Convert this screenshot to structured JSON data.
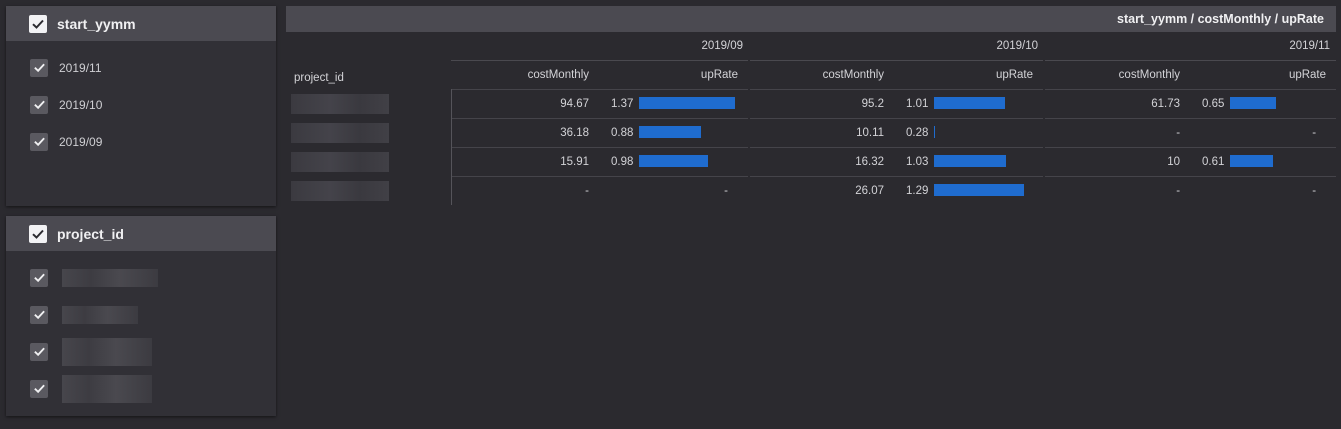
{
  "filters": {
    "yymm": {
      "title": "start_yymm",
      "items": [
        "2019/11",
        "2019/10",
        "2019/09"
      ]
    },
    "project": {
      "title": "project_id"
    }
  },
  "pivot": {
    "title": "start_yymm / costMonthly / upRate",
    "row_header": "project_id",
    "months": [
      "2019/09",
      "2019/10",
      "2019/11"
    ],
    "col_cost": "costMonthly",
    "col_rate": "upRate",
    "rows": [
      [
        {
          "cost": "94.67",
          "rate": "1.37",
          "rate_value": 1.37
        },
        {
          "cost": "95.2",
          "rate": "1.01",
          "rate_value": 1.01
        },
        {
          "cost": "61.73",
          "rate": "0.65",
          "rate_value": 0.65
        }
      ],
      [
        {
          "cost": "36.18",
          "rate": "0.88",
          "rate_value": 0.88
        },
        {
          "cost": "10.11",
          "rate": "0.28",
          "rate_value": 0.02
        },
        {
          "cost": "-",
          "rate": "-",
          "rate_value": null
        }
      ],
      [
        {
          "cost": "15.91",
          "rate": "0.98",
          "rate_value": 0.98
        },
        {
          "cost": "16.32",
          "rate": "1.03",
          "rate_value": 1.03
        },
        {
          "cost": "10",
          "rate": "0.61",
          "rate_value": 0.61
        }
      ],
      [
        {
          "cost": "-",
          "rate": "-",
          "rate_value": null
        },
        {
          "cost": "26.07",
          "rate": "1.29",
          "rate_value": 1.29
        },
        {
          "cost": "-",
          "rate": "-",
          "rate_value": null
        }
      ]
    ],
    "bar_max": 1.37,
    "bar_color": "#1f6ccf"
  },
  "colors": {
    "background": "#2b2a2f",
    "panel": "#313036",
    "header": "#4b4a51"
  }
}
